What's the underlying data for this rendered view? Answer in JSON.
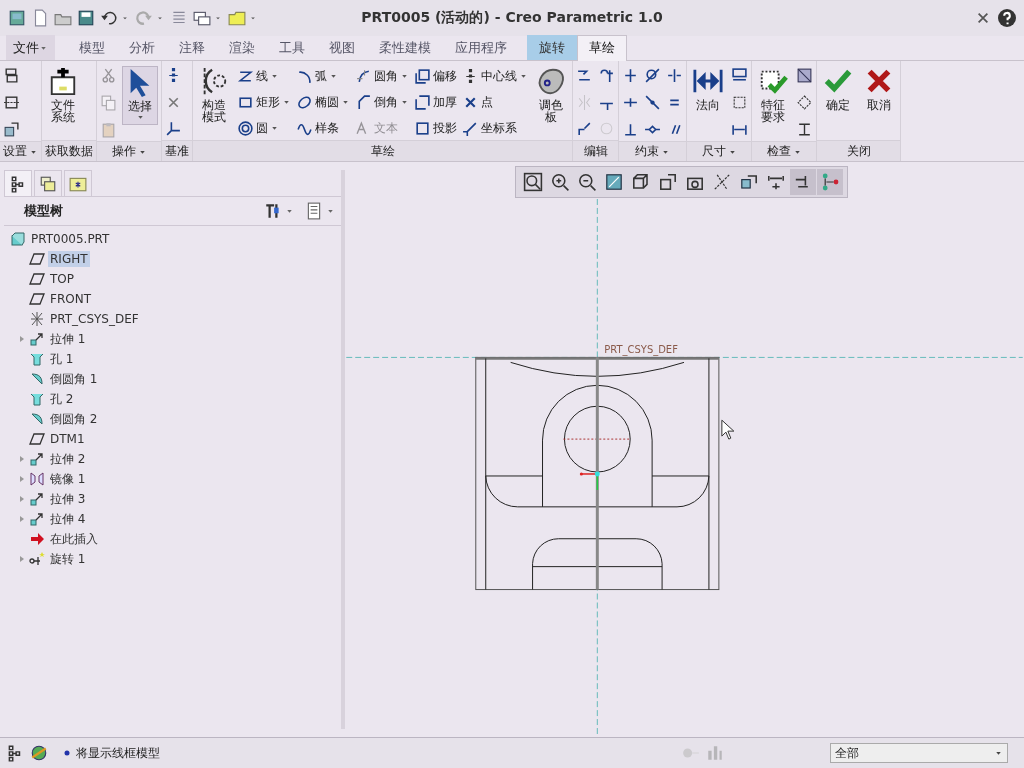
{
  "window": {
    "title": "PRT0005 (活动的) - Creo Parametric 1.0"
  },
  "tabs": [
    {
      "label": "文件",
      "kind": "menu",
      "selected": false
    },
    {
      "label": "模型",
      "kind": "tab",
      "selected": false
    },
    {
      "label": "分析",
      "kind": "tab",
      "selected": false
    },
    {
      "label": "注释",
      "kind": "tab",
      "selected": false
    },
    {
      "label": "渲染",
      "kind": "tab",
      "selected": false
    },
    {
      "label": "工具",
      "kind": "tab",
      "selected": false
    },
    {
      "label": "视图",
      "kind": "tab",
      "selected": false
    },
    {
      "label": "柔性建模",
      "kind": "tab",
      "selected": false
    },
    {
      "label": "应用程序",
      "kind": "tab",
      "selected": false
    },
    {
      "label": "旋转",
      "kind": "context",
      "selected": false
    },
    {
      "label": "草绘",
      "kind": "tab",
      "selected": true
    }
  ],
  "ribbon": [
    {
      "label": "设置",
      "dropdown": true,
      "columns": [
        [
          {
            "kind": "small",
            "disabled": false
          },
          {
            "kind": "small",
            "disabled": false
          },
          {
            "kind": "small",
            "disabled": false
          }
        ]
      ]
    },
    {
      "label": "获取数据",
      "dropdown": false,
      "columns": [
        [
          {
            "kind": "big",
            "label": "文件系统",
            "dropdown": false,
            "disabled": false
          }
        ]
      ]
    },
    {
      "label": "操作",
      "dropdown": true,
      "columns": [
        [
          {
            "kind": "small",
            "disabled": true
          },
          {
            "kind": "small",
            "disabled": true
          },
          {
            "kind": "small",
            "disabled": true
          }
        ],
        [
          {
            "kind": "big",
            "label": "选择",
            "dropdown": true,
            "disabled": false
          }
        ]
      ]
    },
    {
      "label": "基准",
      "dropdown": false,
      "columns": [
        [
          {
            "kind": "small",
            "disabled": false
          },
          {
            "kind": "small",
            "disabled": false
          },
          {
            "kind": "small",
            "disabled": false
          }
        ]
      ]
    },
    {
      "label": "草绘",
      "dropdown": false,
      "columns": [
        [
          {
            "kind": "big",
            "label": "构造模式",
            "dropdown": false,
            "disabled": false
          }
        ],
        [
          {
            "kind": "row",
            "label": "线",
            "dropdown": true,
            "disabled": false
          },
          {
            "kind": "row",
            "label": "矩形",
            "dropdown": true,
            "disabled": false
          },
          {
            "kind": "row",
            "label": "圆",
            "dropdown": true,
            "disabled": false
          }
        ],
        [
          {
            "kind": "row",
            "label": "弧",
            "dropdown": true,
            "disabled": false
          },
          {
            "kind": "row",
            "label": "椭圆",
            "dropdown": true,
            "disabled": false
          },
          {
            "kind": "row",
            "label": "样条",
            "dropdown": false,
            "disabled": false
          }
        ],
        [
          {
            "kind": "row",
            "label": "圆角",
            "dropdown": true,
            "disabled": false
          },
          {
            "kind": "row",
            "label": "倒角",
            "dropdown": true,
            "disabled": false
          },
          {
            "kind": "row",
            "label": "文本",
            "dropdown": false,
            "disabled": true
          }
        ],
        [
          {
            "kind": "row",
            "label": "偏移",
            "dropdown": false,
            "disabled": false
          },
          {
            "kind": "row",
            "label": "加厚",
            "dropdown": false,
            "disabled": false
          },
          {
            "kind": "row",
            "label": "投影",
            "dropdown": false,
            "disabled": false
          }
        ],
        [
          {
            "kind": "row",
            "label": "中心线",
            "dropdown": true,
            "disabled": false
          },
          {
            "kind": "row",
            "label": "点",
            "dropdown": false,
            "disabled": false
          },
          {
            "kind": "row",
            "label": "坐标系",
            "dropdown": false,
            "disabled": false
          }
        ],
        [
          {
            "kind": "big",
            "label": "调色板",
            "dropdown": false,
            "disabled": false
          }
        ]
      ]
    },
    {
      "label": "编辑",
      "dropdown": false,
      "columns": [
        [
          {
            "kind": "small",
            "disabled": false
          },
          {
            "kind": "small",
            "disabled": true
          },
          {
            "kind": "small",
            "disabled": false
          }
        ],
        [
          {
            "kind": "small",
            "disabled": false
          },
          {
            "kind": "small",
            "disabled": false
          },
          {
            "kind": "small",
            "disabled": true
          }
        ]
      ]
    },
    {
      "label": "约束",
      "dropdown": true,
      "columns": [
        [
          {
            "kind": "small",
            "disabled": false
          },
          {
            "kind": "small",
            "disabled": false
          },
          {
            "kind": "small",
            "disabled": false
          }
        ],
        [
          {
            "kind": "small",
            "disabled": false
          },
          {
            "kind": "small",
            "disabled": false
          },
          {
            "kind": "small",
            "disabled": false
          }
        ],
        [
          {
            "kind": "small",
            "disabled": false
          },
          {
            "kind": "small",
            "disabled": false
          },
          {
            "kind": "small",
            "disabled": false
          }
        ]
      ]
    },
    {
      "label": "尺寸",
      "dropdown": true,
      "columns": [
        [
          {
            "kind": "big",
            "label": "法向",
            "dropdown": false,
            "disabled": false
          }
        ],
        [
          {
            "kind": "small",
            "disabled": false
          },
          {
            "kind": "small",
            "disabled": false
          },
          {
            "kind": "small",
            "disabled": false
          }
        ]
      ]
    },
    {
      "label": "检查",
      "dropdown": true,
      "columns": [
        [
          {
            "kind": "big",
            "label": "特征要求",
            "dropdown": false,
            "disabled": false
          }
        ],
        [
          {
            "kind": "small",
            "disabled": false
          },
          {
            "kind": "small",
            "disabled": false
          },
          {
            "kind": "small",
            "disabled": false
          }
        ]
      ]
    },
    {
      "label": "关闭",
      "dropdown": false,
      "columns": [
        [
          {
            "kind": "big",
            "label": "确定",
            "dropdown": false,
            "disabled": false
          }
        ],
        [
          {
            "kind": "big",
            "label": "取消",
            "dropdown": false,
            "disabled": false
          }
        ]
      ]
    }
  ],
  "panel": {
    "title": "模型树"
  },
  "tree": [
    {
      "label": "PRT0005.PRT",
      "kind": "part",
      "expandable": false,
      "selected": false
    },
    {
      "label": "RIGHT",
      "kind": "plane",
      "expandable": false,
      "selected": true
    },
    {
      "label": "TOP",
      "kind": "plane",
      "expandable": false,
      "selected": false
    },
    {
      "label": "FRONT",
      "kind": "plane",
      "expandable": false,
      "selected": false
    },
    {
      "label": "PRT_CSYS_DEF",
      "kind": "csys",
      "expandable": false,
      "selected": false
    },
    {
      "label": "拉伸 1",
      "kind": "extrude",
      "expandable": true,
      "selected": false
    },
    {
      "label": "孔 1",
      "kind": "hole",
      "expandable": false,
      "selected": false
    },
    {
      "label": "倒圆角 1",
      "kind": "round",
      "expandable": false,
      "selected": false
    },
    {
      "label": "孔 2",
      "kind": "hole",
      "expandable": false,
      "selected": false
    },
    {
      "label": "倒圆角 2",
      "kind": "round",
      "expandable": false,
      "selected": false
    },
    {
      "label": "DTM1",
      "kind": "plane",
      "expandable": false,
      "selected": false
    },
    {
      "label": "拉伸 2",
      "kind": "extrude",
      "expandable": true,
      "selected": false
    },
    {
      "label": "镜像 1",
      "kind": "mirror",
      "expandable": true,
      "selected": false
    },
    {
      "label": "拉伸 3",
      "kind": "extrude",
      "expandable": true,
      "selected": false
    },
    {
      "label": "拉伸 4",
      "kind": "extrude",
      "expandable": true,
      "selected": false
    },
    {
      "label": "在此插入",
      "kind": "insert",
      "expandable": false,
      "selected": false
    },
    {
      "label": "旋转 1",
      "kind": "revolve",
      "expandable": true,
      "selected": false
    }
  ],
  "view_toolbar": [
    {
      "selected": false
    },
    {
      "selected": false
    },
    {
      "selected": false
    },
    {
      "selected": false
    },
    {
      "selected": false
    },
    {
      "selected": false
    },
    {
      "selected": false
    },
    {
      "selected": false
    },
    {
      "selected": false
    },
    {
      "selected": false
    },
    {
      "selected": true
    },
    {
      "selected": true
    }
  ],
  "canvas": {
    "csys_label": "PRT_CSYS_DEF"
  },
  "status_bar": {
    "message": "将显示线框模型",
    "filter": "全部"
  }
}
